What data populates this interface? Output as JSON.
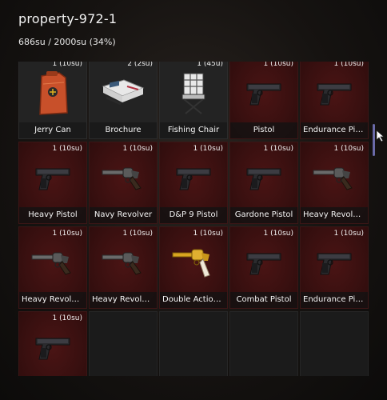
{
  "header": {
    "title": "property-972-1"
  },
  "capacity": {
    "text": "686su / 2000su (34%)"
  },
  "slots": [
    {
      "name": "Jerry Can",
      "count": "1 (10su)",
      "style": "dark",
      "icon": "jerry-can-icon"
    },
    {
      "name": "Brochure",
      "count": "2 (2su)",
      "style": "dark",
      "icon": "brochure-icon"
    },
    {
      "name": "Fishing Chair",
      "count": "1 (45u)",
      "style": "dark",
      "icon": "fishing-chair-icon"
    },
    {
      "name": "Pistol",
      "count": "1 (10su)",
      "style": "red",
      "icon": "pistol-icon"
    },
    {
      "name": "Endurance Pis...",
      "count": "1 (10su)",
      "style": "red",
      "icon": "pistol-icon"
    },
    {
      "name": "Heavy Pistol",
      "count": "1 (10su)",
      "style": "red",
      "icon": "pistol-icon"
    },
    {
      "name": "Navy Revolver",
      "count": "1 (10su)",
      "style": "red",
      "icon": "revolver-icon"
    },
    {
      "name": "D&P 9 Pistol",
      "count": "1 (10su)",
      "style": "red",
      "icon": "pistol-icon"
    },
    {
      "name": "Gardone Pistol",
      "count": "1 (10su)",
      "style": "red",
      "icon": "pistol-icon"
    },
    {
      "name": "Heavy Revolve...",
      "count": "1 (10su)",
      "style": "red",
      "icon": "revolver-icon"
    },
    {
      "name": "Heavy Revolve...",
      "count": "1 (10su)",
      "style": "red",
      "icon": "revolver-icon"
    },
    {
      "name": "Heavy Revolver",
      "count": "1 (10su)",
      "style": "red",
      "icon": "revolver-icon"
    },
    {
      "name": "Double Action...",
      "count": "1 (10su)",
      "style": "red",
      "icon": "gold-revolver-icon"
    },
    {
      "name": "Combat Pistol",
      "count": "1 (10su)",
      "style": "red",
      "icon": "pistol-icon"
    },
    {
      "name": "Endurance Pis...",
      "count": "1 (10su)",
      "style": "red",
      "icon": "pistol-icon"
    },
    {
      "name": "",
      "count": "1 (10su)",
      "style": "red",
      "icon": "pistol-icon"
    },
    {
      "name": "",
      "count": "",
      "style": "empty",
      "icon": ""
    },
    {
      "name": "",
      "count": "",
      "style": "empty",
      "icon": ""
    },
    {
      "name": "",
      "count": "",
      "style": "empty",
      "icon": ""
    },
    {
      "name": "",
      "count": "",
      "style": "empty",
      "icon": ""
    }
  ]
}
